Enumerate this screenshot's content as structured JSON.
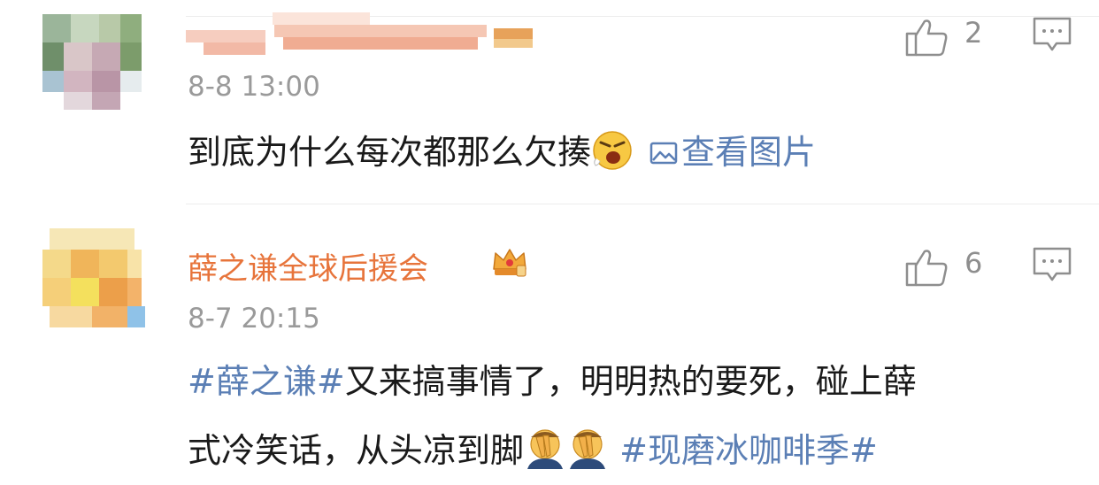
{
  "comments": [
    {
      "author": "",
      "time": "8-8 13:00",
      "text": "到底为什么每次都那么欠揍",
      "view_image_label": "查看图片",
      "like_count": "2"
    },
    {
      "author": "薛之谦全球后援会",
      "time": "8-7 20:15",
      "text_line1_tag": "#薛之谦#",
      "text_line1": "又来搞事情了，明明热的要死，碰上薛",
      "text_line2": "式冷笑话，从头凉到脚",
      "text_line2_tag": "#现磨冰咖啡季#",
      "like_count": "6"
    }
  ],
  "icons": {
    "like": "thumbs-up-icon",
    "reply": "comment-icon",
    "image": "image-icon",
    "badge": "crown-badge-icon",
    "emoji_angry": "angry-face-emoji",
    "emoji_facepalm": "facepalm-emoji"
  },
  "colors": {
    "author": "#e7743b",
    "link": "#5b7fb5",
    "meta": "#9a9a9a",
    "icon": "#8e8e8e"
  }
}
